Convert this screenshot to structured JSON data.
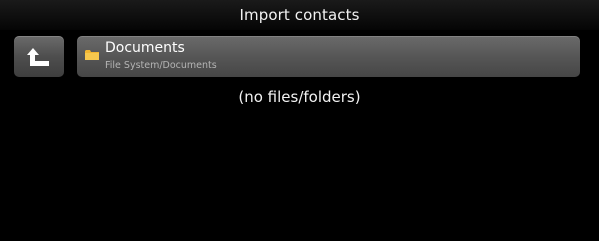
{
  "header": {
    "title": "Import contacts"
  },
  "back_button": {
    "icon": "up-arrow-icon"
  },
  "folder": {
    "icon": "folder-icon",
    "name": "Documents",
    "path": "File System/Documents"
  },
  "empty_message": "(no files/folders)",
  "colors": {
    "background": "#000000",
    "button": "#555555",
    "folder": "#f2b632"
  }
}
